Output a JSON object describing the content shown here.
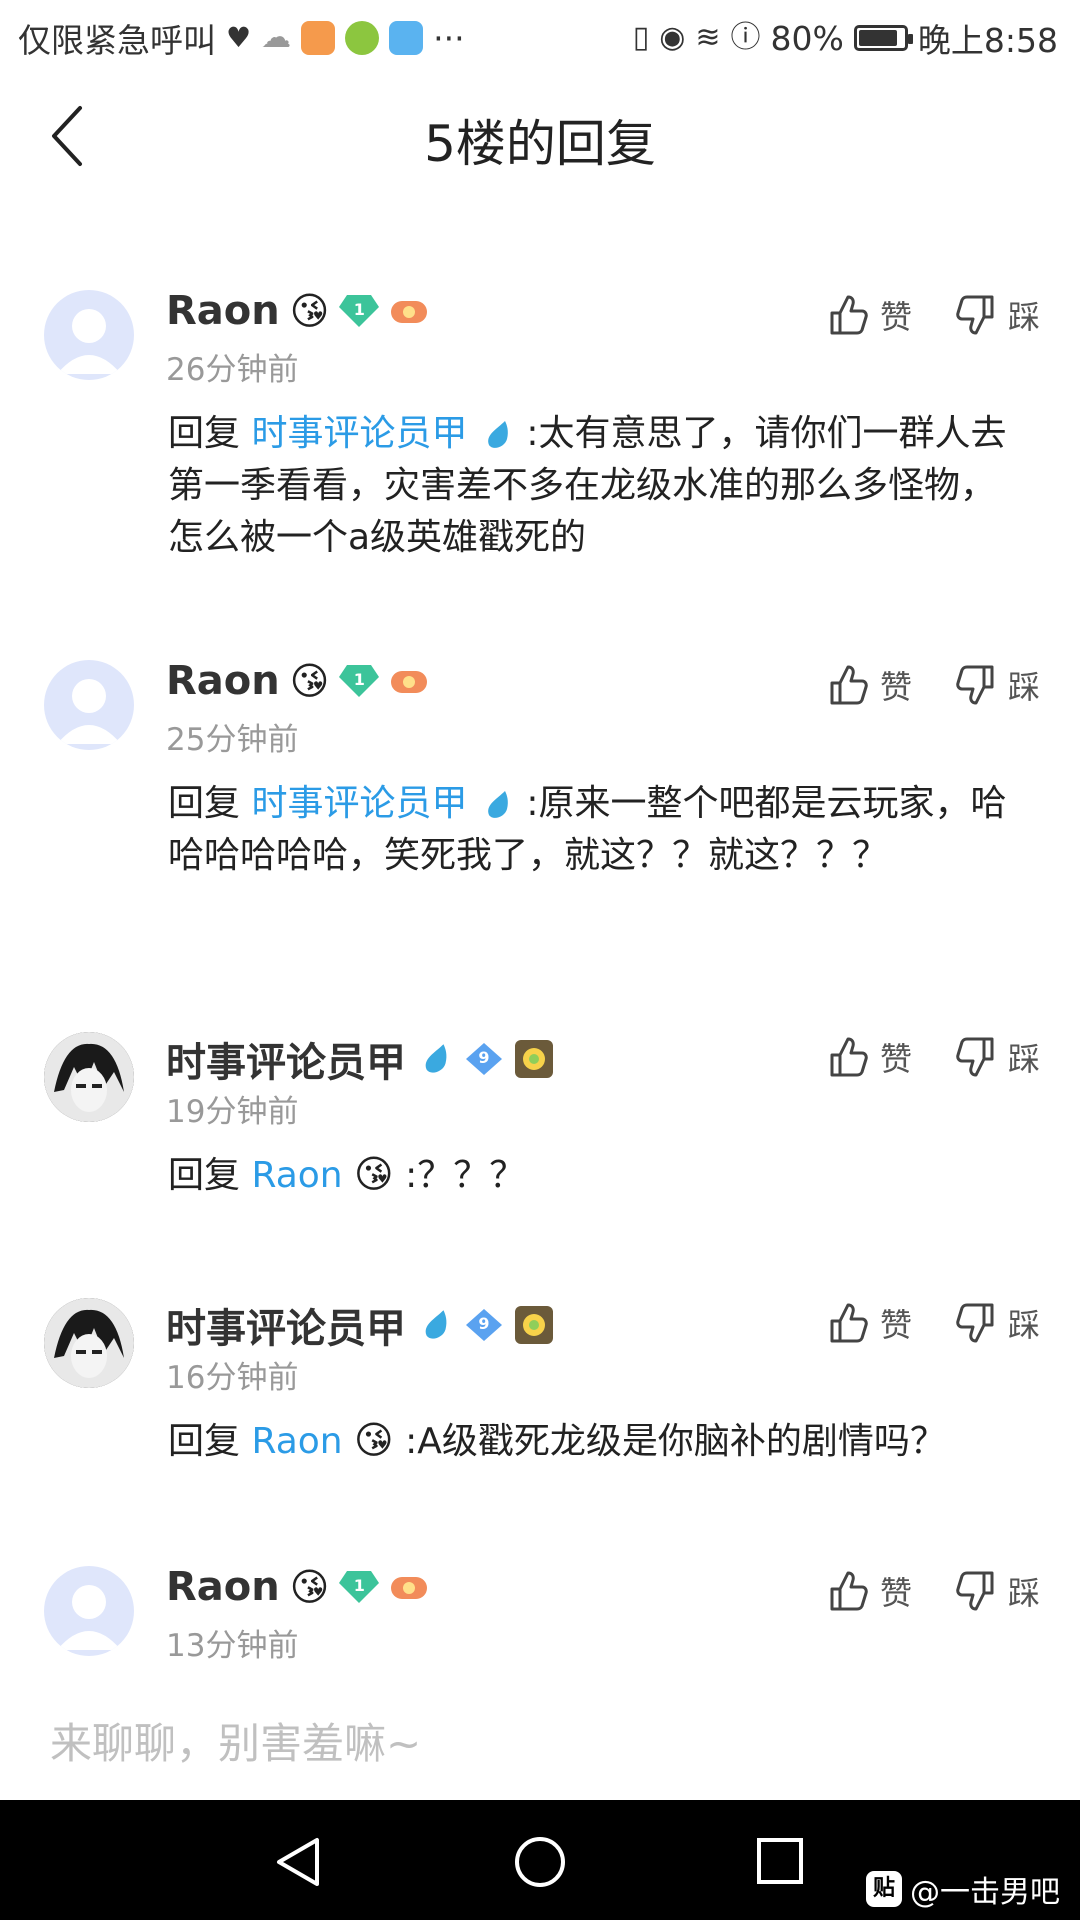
{
  "status_bar": {
    "carrier_text": "仅限紧急呼叫",
    "more": "···",
    "battery_text": "80%",
    "battery_level": 0.8,
    "time": "晚上8:58"
  },
  "header": {
    "title": "5楼的回复"
  },
  "comments": [
    {
      "username": "Raon",
      "user_emoji": "😘",
      "level": "1",
      "time": "26分钟前",
      "reply_prefix": "回复",
      "reply_to": "时事评论员甲",
      "reply_to_emoji": "",
      "text": ":太有意思了，请你们一群人去第一季看看，灾害差不多在龙级水准的那么多怪物，怎么被一个a级英雄戳死的",
      "like_label": "赞",
      "dislike_label": "踩"
    },
    {
      "username": "Raon",
      "user_emoji": "😘",
      "level": "1",
      "time": "25分钟前",
      "reply_prefix": "回复",
      "reply_to": "时事评论员甲",
      "reply_to_emoji": "",
      "text": ":原来一整个吧都是云玩家，哈哈哈哈哈哈，笑死我了，就这？？就这？？？",
      "like_label": "赞",
      "dislike_label": "踩"
    },
    {
      "username": "时事评论员甲",
      "user_emoji": "",
      "level": "9",
      "time": "19分钟前",
      "reply_prefix": "回复",
      "reply_to": "Raon",
      "reply_to_emoji": "😘",
      "text": ":？？？",
      "like_label": "赞",
      "dislike_label": "踩"
    },
    {
      "username": "时事评论员甲",
      "user_emoji": "",
      "level": "9",
      "time": "16分钟前",
      "reply_prefix": "回复",
      "reply_to": "Raon",
      "reply_to_emoji": "😘",
      "text": ":A级戳死龙级是你脑补的剧情吗？",
      "like_label": "赞",
      "dislike_label": "踩"
    },
    {
      "username": "Raon",
      "user_emoji": "😘",
      "level": "1",
      "time": "13分钟前",
      "like_label": "赞",
      "dislike_label": "踩"
    }
  ],
  "input": {
    "placeholder": "来聊聊，别害羞嘛~"
  },
  "watermark": {
    "icon_text": "贴",
    "text": "@一击男吧"
  }
}
